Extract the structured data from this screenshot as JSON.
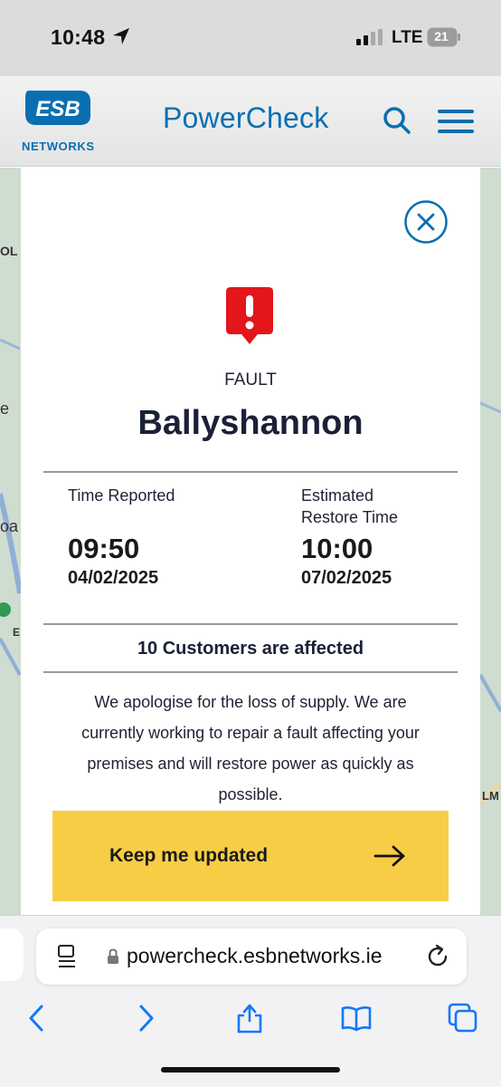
{
  "status_bar": {
    "time": "10:48",
    "network": "LTE",
    "battery": "21"
  },
  "header": {
    "logo_text": "ESB",
    "logo_subtext": "NETWORKS",
    "title": "PowerCheck",
    "brand_color": "#0a6fb0"
  },
  "map": {
    "labels": [
      "OL",
      "e",
      "oa",
      "E",
      "LM"
    ],
    "background": "#cfdcd0"
  },
  "outage": {
    "type": "FAULT",
    "location": "Ballyshannon",
    "time_reported_label": "Time Reported",
    "time_reported": "09:50",
    "date_reported": "04/02/2025",
    "restore_label_line1": "Estimated",
    "restore_label_line2": "Restore Time",
    "restore_time": "10:00",
    "restore_date": "07/02/2025",
    "customers_affected": "10 Customers are affected",
    "message": "We apologise for the loss of supply. We are currently working to repair a fault affecting your premises and will restore power as quickly as possible.",
    "cta_label": "Keep me updated",
    "alert_color": "#e3161b",
    "cta_color": "#f8cd46"
  },
  "browser": {
    "url": "powercheck.esbnetworks.ie",
    "icons": [
      "reader-icon",
      "lock-icon",
      "reload-icon",
      "back-icon",
      "forward-icon",
      "share-icon",
      "bookmarks-icon",
      "tabs-icon"
    ]
  }
}
